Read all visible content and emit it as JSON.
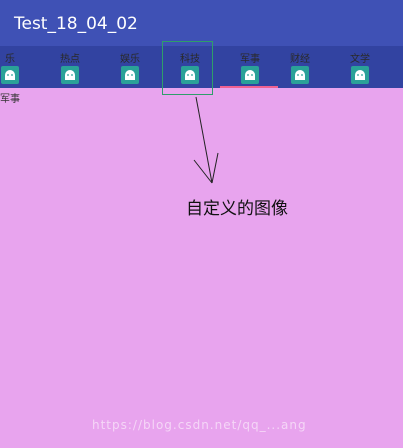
{
  "app": {
    "title": "Test_18_04_02"
  },
  "tabs": [
    {
      "label": "乐",
      "icon": "android-icon"
    },
    {
      "label": "热点",
      "icon": "android-icon"
    },
    {
      "label": "娱乐",
      "icon": "android-icon"
    },
    {
      "label": "科技",
      "icon": "android-icon"
    },
    {
      "label": "军事",
      "icon": "android-icon"
    },
    {
      "label": "财经",
      "icon": "android-icon"
    },
    {
      "label": "文学",
      "icon": "android-icon"
    }
  ],
  "selected_tab": "军事",
  "content": {
    "label": "军事"
  },
  "annotation": {
    "text": "自定义的图像"
  },
  "watermark": {
    "text": "https://blog.csdn.net/qq_...ang"
  },
  "colors": {
    "appbar": "#3f51b5",
    "tabbar": "#3243a1",
    "content_bg": "#e8a4ee",
    "indicator": "#f06292",
    "icon": "#2aa198"
  }
}
